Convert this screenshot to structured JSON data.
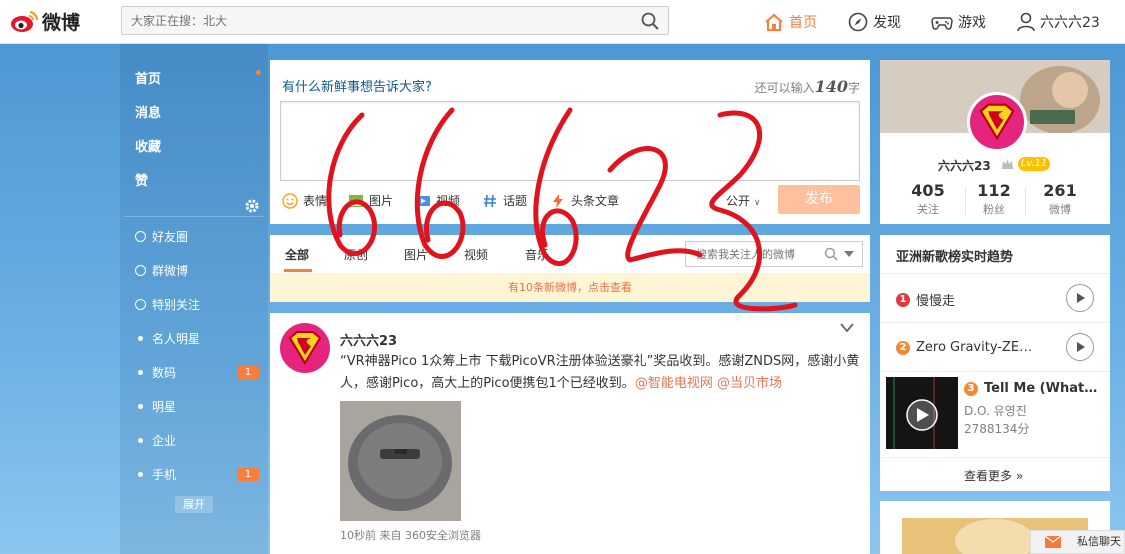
{
  "topbar": {
    "logo_text": "微博",
    "search_placeholder": "大家正在搜：北大",
    "nav": {
      "home": "首页",
      "find": "发现",
      "game": "游戏",
      "user": "六六六23"
    }
  },
  "leftnav": {
    "main_items": [
      "首页",
      "消息",
      "收藏",
      "赞"
    ],
    "groups": [
      "好友圈",
      "群微博",
      "特别关注",
      "名人明星",
      "数码",
      "明星",
      "企业",
      "手机"
    ],
    "counts": {
      "shuma": "1",
      "shouji": "1"
    },
    "expand_label": "展开"
  },
  "publisher": {
    "prompt": "有什么新鲜事想告诉大家?",
    "limit_prefix": "还可以输入",
    "limit_num": "140",
    "limit_suffix": "字",
    "tools": [
      "表情",
      "图片",
      "视频",
      "话题",
      "头条文章"
    ],
    "visibility": "公开",
    "publish_label": "发布"
  },
  "feed_tabs": {
    "tabs": [
      "全部",
      "原创",
      "图片",
      "视频",
      "音乐"
    ],
    "search_placeholder": "搜索我关注人的微博",
    "notice": "有10条新微博，点击查看"
  },
  "post": {
    "author": "六六六23",
    "text_main": "“VR神器Pico 1众筹上市 下载PicoVR注册体验送豪礼”奖品收到。感谢ZNDS网，感谢小黄人，感谢Pico，高大上的Pico便携包1个已经收到。",
    "mention1": "@智能电视网",
    "mention2": "@当贝市场",
    "meta": "10秒前 来自 360安全浏览器"
  },
  "profile": {
    "name": "六六六23",
    "level": "Lv.11",
    "stats": [
      {
        "num": "405",
        "label": "关注"
      },
      {
        "num": "112",
        "label": "粉丝"
      },
      {
        "num": "261",
        "label": "微博"
      }
    ]
  },
  "music": {
    "heading": "亚洲新歌榜实时趋势",
    "items": [
      {
        "rank": "1",
        "title": "慢慢走"
      },
      {
        "rank": "2",
        "title": "Zero Gravity-ZE…"
      },
      {
        "rank": "3",
        "title": "Tell Me (What…",
        "artist": "D.O. 유영진",
        "score": "2788134分"
      }
    ],
    "more": "查看更多 »"
  },
  "chat": {
    "label": "私信聊天"
  },
  "handwriting": "66623",
  "colors": {
    "accent": "#fa7d3c",
    "link": "#eb7350",
    "bg_blue": "#5aa0d8",
    "level": "#ffc000"
  }
}
